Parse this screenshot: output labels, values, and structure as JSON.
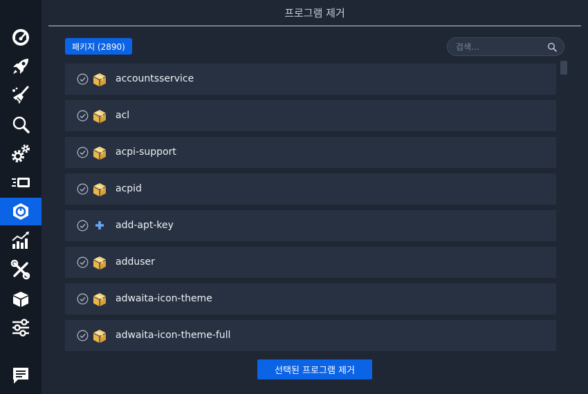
{
  "window": {
    "title": "프로그램 제거"
  },
  "sidebar": {
    "items": [
      {
        "icon": "dashboard-icon"
      },
      {
        "icon": "rocket-icon"
      },
      {
        "icon": "broom-icon"
      },
      {
        "icon": "search-icon"
      },
      {
        "icon": "gears-icon"
      },
      {
        "icon": "services-icon"
      },
      {
        "icon": "uninstaller-icon",
        "active": true
      },
      {
        "icon": "chart-icon"
      },
      {
        "icon": "tools-icon"
      },
      {
        "icon": "package-icon"
      },
      {
        "icon": "settings-sliders-icon"
      },
      {
        "icon": "feedback-icon"
      }
    ]
  },
  "packages": {
    "badge": "패키지 (2890)"
  },
  "search": {
    "placeholder": "검색..."
  },
  "list": {
    "items": [
      {
        "name": "accountsservice",
        "icon": "package-box-icon"
      },
      {
        "name": "acl",
        "icon": "package-box-icon"
      },
      {
        "name": "acpi-support",
        "icon": "package-box-icon"
      },
      {
        "name": "acpid",
        "icon": "package-box-icon"
      },
      {
        "name": "add-apt-key",
        "icon": "plus-icon"
      },
      {
        "name": "adduser",
        "icon": "package-box-icon"
      },
      {
        "name": "adwaita-icon-theme",
        "icon": "package-box-icon"
      },
      {
        "name": "adwaita-icon-theme-full",
        "icon": "package-box-icon"
      }
    ]
  },
  "actions": {
    "remove_selected": "선택된 프로그램 제거"
  },
  "colors": {
    "accent": "#0b63e5",
    "background": "#1f2734",
    "row": "#273142",
    "sidebar": "#141a23"
  }
}
